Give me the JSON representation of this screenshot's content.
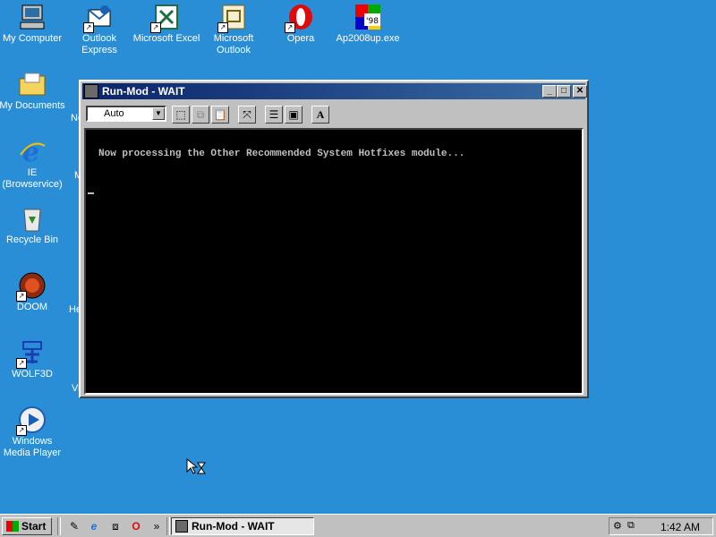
{
  "desktop": {
    "icons": [
      {
        "label": "My Computer",
        "icon": "computer-icon"
      },
      {
        "label": "Outlook Express",
        "icon": "outlook-express-icon"
      },
      {
        "label": "Microsoft Excel",
        "icon": "excel-icon"
      },
      {
        "label": "Microsoft Outlook",
        "icon": "outlook-icon"
      },
      {
        "label": "Opera",
        "icon": "opera-icon"
      },
      {
        "label": "Ap2008up.exe",
        "icon": "windows98-setup-icon"
      },
      {
        "label": "My Documents",
        "icon": "folder-icon"
      },
      {
        "label": "IE (Browservice)",
        "icon": "internet-explorer-icon"
      },
      {
        "label": "Recycle Bin",
        "icon": "recycle-bin-icon"
      },
      {
        "label": "DOOM",
        "icon": "doom-icon"
      },
      {
        "label": "WOLF3D",
        "icon": "wolf3d-icon"
      },
      {
        "label": "Windows Media Player",
        "icon": "media-player-icon"
      }
    ],
    "partial_labels": [
      "Ne",
      "M",
      "He",
      "Vi"
    ]
  },
  "window": {
    "title": "Run-Mod - WAIT",
    "font_size_value": "Auto",
    "console_text": "Now processing the Other Recommended System Hotfixes module..."
  },
  "taskbar": {
    "start_label": "Start",
    "task_label": "Run-Mod - WAIT",
    "clock": "1:42 AM",
    "quicklaunch_more": "»"
  },
  "colors": {
    "desktop": "#2a8ed6",
    "titlebar": "#0a246a"
  }
}
